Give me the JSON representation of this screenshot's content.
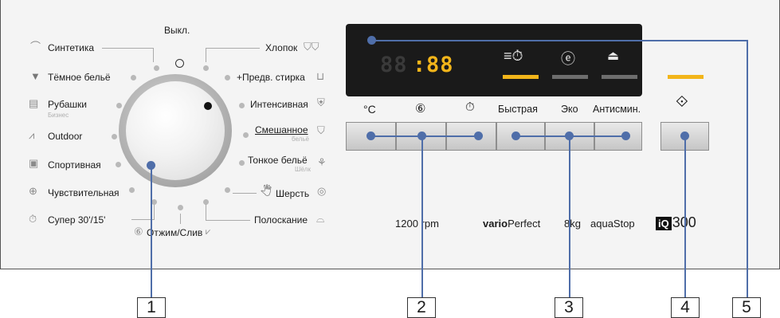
{
  "programs_left": [
    {
      "label": "Синтетика",
      "icon": "synthetics-icon"
    },
    {
      "label": "Тёмное бельё",
      "icon": "dark-laundry-icon"
    },
    {
      "label": "Рубашки",
      "sub": "Бизнес",
      "icon": "shirts-icon"
    },
    {
      "label": "Outdoor",
      "icon": "outdoor-icon"
    },
    {
      "label": "Спортивная",
      "icon": "sportswear-icon"
    },
    {
      "label": "Чувствительная",
      "icon": "sensitive-icon"
    },
    {
      "label": "Супер 30'/15'",
      "icon": "super-quick-icon"
    }
  ],
  "programs_right": [
    {
      "label": "Хлопок",
      "icon": "cotton-icon"
    },
    {
      "label": "+Предв. стирка",
      "icon": "prewash-icon"
    },
    {
      "label": "Интенсивная",
      "icon": "intensive-icon"
    },
    {
      "label": "Смешанное",
      "sub": "бельё",
      "icon": "mixed-icon"
    },
    {
      "label": "Тонкое бельё",
      "sub": "Шёлк",
      "icon": "delicates-icon"
    },
    {
      "label": "Шерсть",
      "icon": "wool-icon"
    },
    {
      "label": "Полоскание",
      "icon": "rinse-icon"
    }
  ],
  "off_label": "Выкл.",
  "spin_label": "Отжим/Слив",
  "display": {
    "digits_left": "88",
    "colon": ":",
    "digits_right": "88"
  },
  "display_icons": [
    "time-delay-icon",
    "eco-icon",
    "iron-icon"
  ],
  "buttons": {
    "temp": "°C",
    "spin": "⑥",
    "time": "⏱",
    "quick": "Быстрая",
    "eco": "Эко",
    "anticrease": "Антисмин.",
    "start": "⟐"
  },
  "specs": {
    "rpm": "1200 rpm",
    "vario_bold": "vario",
    "vario_rest": "Perfect",
    "kg": "8kg",
    "aqua": "aquaStop",
    "model_box": "iQ",
    "model_num": "300"
  },
  "callouts": [
    "1",
    "2",
    "3",
    "4",
    "5"
  ],
  "colors": {
    "accent": "#4f6ea9",
    "amber": "#f2b51a",
    "lcd_bg": "#1a1a1a"
  }
}
